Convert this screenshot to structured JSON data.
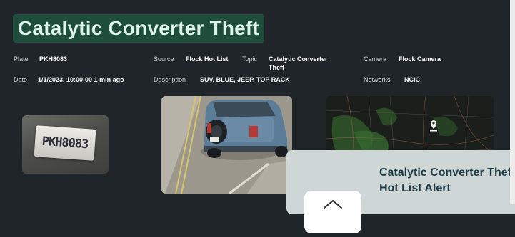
{
  "alert": {
    "title": "Catalytic Converter Theft",
    "plate_label": "Plate",
    "plate_value": "PKH8083",
    "source_label": "Source",
    "source_value": "Flock Hot List",
    "topic_label": "Topic",
    "topic_value_line1": "Catalytic Converter",
    "topic_value_line2": "Theft",
    "camera_label": "Camera",
    "camera_value": "Flock Camera",
    "date_label": "Date",
    "date_value": "1/1/2023, 10:00:00 1 min ago",
    "description_label": "Description",
    "description_value": "SUV, BLUE, JEEP, TOP RACK",
    "networks_label": "Networks",
    "networks_value": "NCIC"
  },
  "images": {
    "plate_text": "PKH8083"
  },
  "toast": {
    "title": "Catalytic Converter Theft Hot List Alert",
    "icon": "home-icon"
  },
  "colors": {
    "background": "#1f2528",
    "title_bg": "#1f4d3c",
    "title_text": "#dff5e9",
    "toast_bg": "#cfd7d6",
    "toast_text": "#1c3a44"
  }
}
